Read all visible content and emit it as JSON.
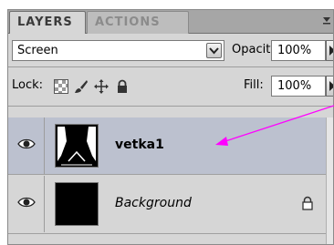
{
  "tabs": [
    {
      "label": "LAYERS"
    },
    {
      "label": "ACTIONS"
    }
  ],
  "blend_mode": {
    "value": "Screen"
  },
  "opacity": {
    "label": "Opacity:",
    "value": "100%"
  },
  "lock": {
    "label": "Lock:",
    "icons": [
      "lock-transparent-pixels-icon",
      "lock-image-pixels-icon",
      "lock-position-icon",
      "lock-all-icon"
    ]
  },
  "fill": {
    "label": "Fill:",
    "value": "100%"
  },
  "layers": [
    {
      "name": "vetka1",
      "selected": true,
      "visible": true
    },
    {
      "name": "Background",
      "selected": false,
      "visible": true,
      "locked": true
    }
  ],
  "colors": {
    "selection": "#bcc1cf",
    "panel": "#d6d6d6",
    "arrow": "#ff00ff"
  }
}
